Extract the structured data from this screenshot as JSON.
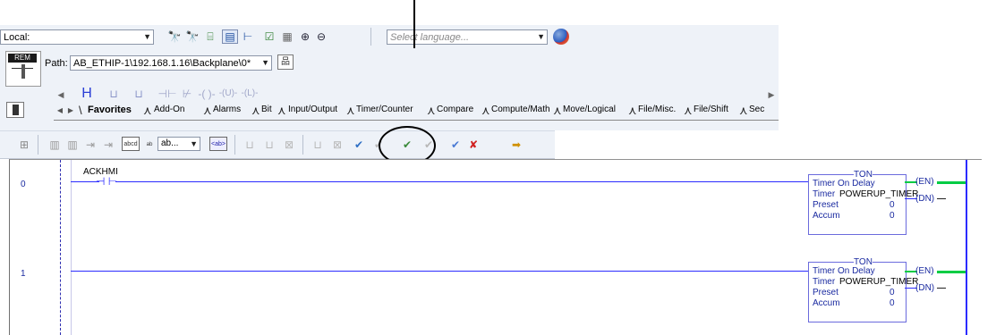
{
  "toolbar": {
    "local_combo_value": "Local:",
    "language_placeholder": "Select language...",
    "rem_label": "REM",
    "path_label": "Path:",
    "path_value": "AB_ETHIP-1\\192.168.1.16\\Backplane\\0*",
    "element_combo_value": "ab..."
  },
  "instruction_tabs": [
    "Favorites",
    "Add-On",
    "Alarms",
    "Bit",
    "Input/Output",
    "Timer/Counter",
    "Compare",
    "Compute/Math",
    "Move/Logical",
    "File/Misc.",
    "File/Shift",
    "Sec"
  ],
  "rungs": [
    {
      "number": "0",
      "contact_tag": "ACKHMI",
      "timer": {
        "type": "TON",
        "title": "Timer On Delay",
        "timer_label": "Timer",
        "timer_tag": "POWERUP_TIMER",
        "preset_label": "Preset",
        "preset_value": "0",
        "accum_label": "Accum",
        "accum_value": "0",
        "en": "EN",
        "dn": "DN"
      }
    },
    {
      "number": "1",
      "timer": {
        "type": "TON",
        "title": "Timer On Delay",
        "timer_label": "Timer",
        "timer_tag": "POWERUP_TIMER",
        "preset_label": "Preset",
        "preset_value": "0",
        "accum_label": "Accum",
        "accum_value": "0",
        "en": "EN",
        "dn": "DN"
      }
    }
  ],
  "colors": {
    "toolbar_bg": "#eef2f8",
    "ladder_wire": "#2b2bff",
    "ladder_text": "#1a2aa0",
    "energized": "#00cc44"
  }
}
